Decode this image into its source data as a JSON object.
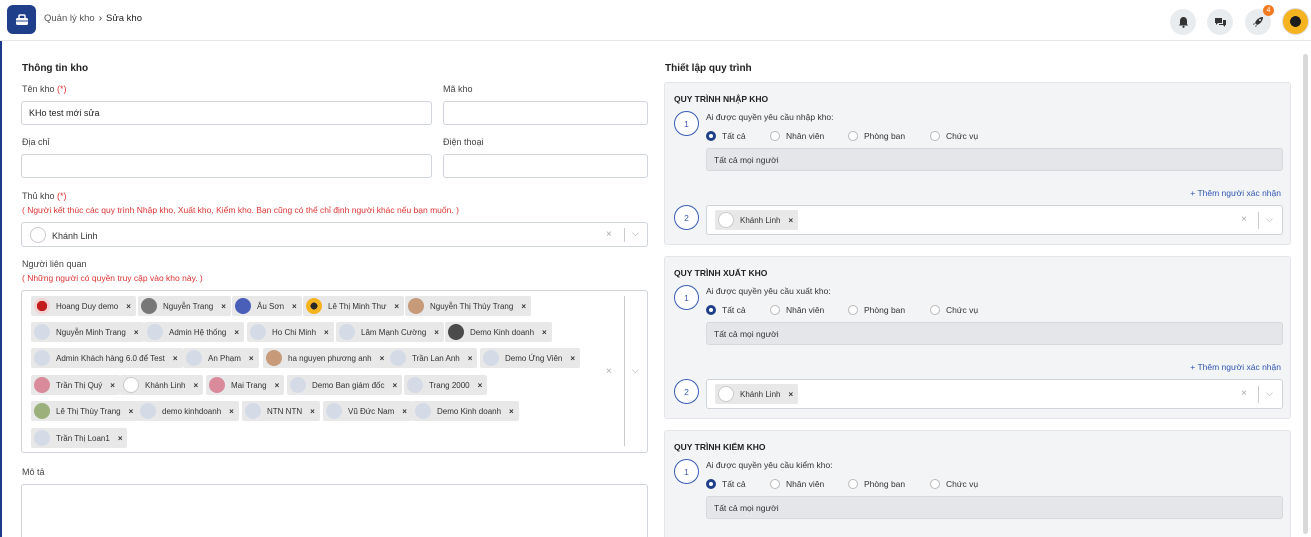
{
  "header": {
    "crumb_parent": "Quản lý kho",
    "crumb_current": "Sửa kho",
    "notification_count": "4"
  },
  "info": {
    "title": "Thông tin kho",
    "name_label": "Tên kho",
    "name_required": "(*)",
    "name_value": "KHo test mới sửa",
    "code_label": "Mã kho",
    "code_value": "",
    "address_label": "Địa chỉ",
    "address_value": "",
    "phone_label": "Điện thoại",
    "phone_value": "",
    "keeper_label": "Thủ kho",
    "keeper_required": "(*)",
    "keeper_hint": "( Người kết thúc các quy trình Nhập kho, Xuất kho, Kiểm kho. Bạn cũng có thể chỉ định người khác nếu bạn muốn. )",
    "keeper_value": "Khánh Linh",
    "related_label": "Người liên quan",
    "related_hint": "( Những người có quyền truy cập vào kho này. )",
    "related": [
      "Hoang Duy demo",
      "Nguyễn Trang",
      "Âu Sơn",
      "Lê Thị Minh Thư",
      "Nguyễn Thị Thùy Trang",
      "Nguyễn Minh Trang",
      "Admin Hệ thống",
      "Ho Chi Minh",
      "Lâm Mạnh Cường",
      "Demo Kinh doanh",
      "Admin Khách hàng 6.0 để Test",
      "An Phạm",
      "ha nguyen phương anh",
      "Trần Lan Anh",
      "Demo Ứng Viên",
      "Trần Thị Quý",
      "Khánh Linh",
      "Mai Trang",
      "Demo Ban giám đốc",
      "Trang 2000",
      "Lê Thị Thùy Trang",
      "demo kinhdoanh",
      "NTN NTN",
      "Vũ Đức Nam",
      "Demo Kinh doanh",
      "Trần Thị Loan1"
    ],
    "desc_label": "Mô tả"
  },
  "workflow": {
    "title": "Thiết lập quy trình",
    "processes": [
      {
        "title": "QUY TRÌNH NHẬP KHO",
        "question": "Ai được quyền yêu cầu nhập kho:",
        "step1": "1",
        "step2": "2",
        "all_text": "Tất cả mọi người",
        "add_link": "+ Thêm người xác nhận",
        "confirmer": "Khánh Linh"
      },
      {
        "title": "QUY TRÌNH XUẤT KHO",
        "question": "Ai được quyền yêu cầu xuất kho:",
        "step1": "1",
        "step2": "2",
        "all_text": "Tất cả mọi người",
        "add_link": "+ Thêm người xác nhận",
        "confirmer": "Khánh Linh"
      },
      {
        "title": "QUY TRÌNH KIỂM KHO",
        "question": "Ai được quyền yêu cầu kiểm kho:",
        "step1": "1",
        "all_text": "Tất cả mọi người"
      }
    ],
    "options": [
      "Tất cả",
      "Nhân viên",
      "Phòng ban",
      "Chức vụ"
    ]
  },
  "colors": {
    "primary": "#1f3f8a",
    "accent": "#f47a21",
    "required": "#d33333",
    "link": "#2f55b3"
  }
}
